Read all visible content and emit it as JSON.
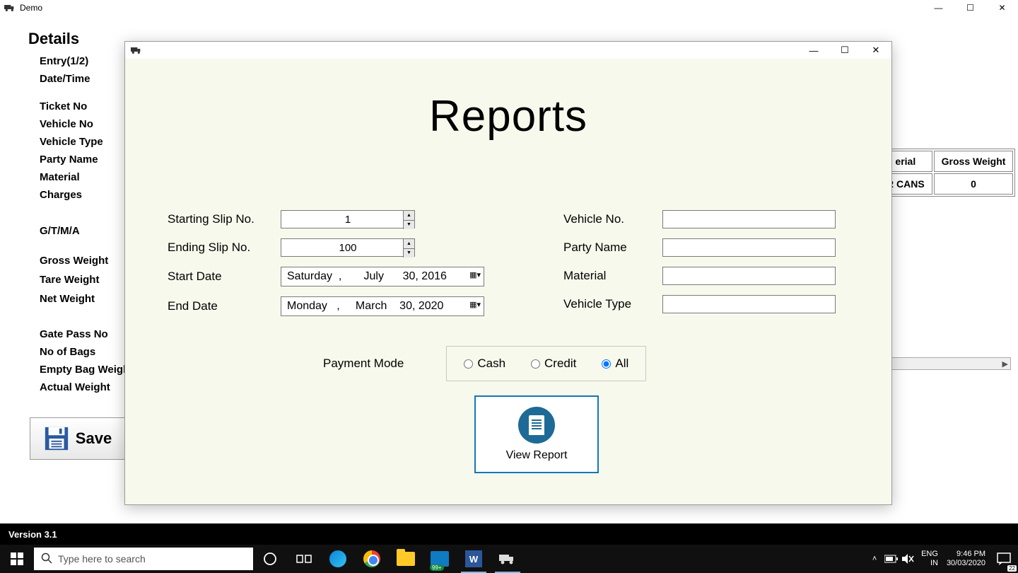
{
  "main_window": {
    "title": "Demo"
  },
  "details": {
    "heading": "Details",
    "items": [
      "Entry(1/2)",
      "Date/Time",
      "Ticket No",
      "Vehicle No",
      "Vehicle Type",
      "Party Name",
      "Material",
      "Charges",
      "G/T/M/A"
    ],
    "weights": [
      "Gross Weight",
      "Tare Weight",
      "Net Weight"
    ],
    "extras": [
      "Gate Pass No",
      "No of Bags",
      "Empty Bag Weigh",
      "Actual Weight"
    ]
  },
  "save_button": {
    "label": "Save"
  },
  "bg_table": {
    "headers": [
      "erial",
      "Gross Weight"
    ],
    "row": [
      "R CANS",
      "0"
    ]
  },
  "dialog": {
    "heading": "Reports",
    "left": {
      "starting_slip_label": "Starting Slip No.",
      "starting_slip_value": "1",
      "ending_slip_label": "Ending Slip No.",
      "ending_slip_value": "100",
      "start_date_label": "Start Date",
      "start_date_value": "Saturday  ,       July      30, 2016",
      "end_date_label": "End Date",
      "end_date_value": "Monday   ,     March    30, 2020"
    },
    "right": {
      "vehicle_no_label": "Vehicle No.",
      "party_name_label": "Party Name",
      "material_label": "Material",
      "vehicle_type_label": "Vehicle Type"
    },
    "payment_mode": {
      "label": "Payment Mode",
      "options": [
        "Cash",
        "Credit",
        "All"
      ],
      "selected": "All"
    },
    "view_report_label": "View Report"
  },
  "version_bar": "Version 3.1",
  "taskbar": {
    "search_placeholder": "Type here to search",
    "lang1": "ENG",
    "lang2": "IN",
    "time": "9:46 PM",
    "date": "30/03/2020",
    "notif_count": "22",
    "store_badge": "99+"
  }
}
